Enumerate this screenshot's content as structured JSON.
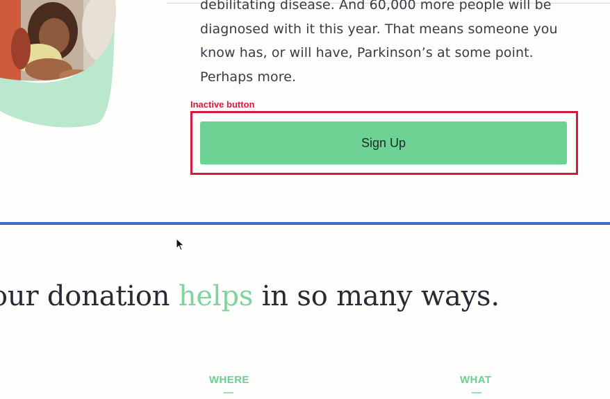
{
  "intro": {
    "lines": [
      "debilitating disease. And 60,000 more people will be",
      "diagnosed with it this year. That means someone you",
      "know has, or will have, Parkinson’s at some point.",
      "Perhaps more."
    ]
  },
  "annotation": {
    "label": "Inactive button"
  },
  "signup": {
    "label": "Sign Up"
  },
  "headline": {
    "before": "our donation ",
    "highlight": "helps",
    "after": " in so many ways."
  },
  "columns": [
    {
      "label": "WHERE"
    },
    {
      "label": "WHAT"
    }
  ],
  "colors": {
    "accent_green": "#6dd294",
    "annotation_red": "#d8183f",
    "divider_blue": "#2b63c5"
  },
  "icons": {
    "cursor": "arrow-cursor-icon"
  }
}
